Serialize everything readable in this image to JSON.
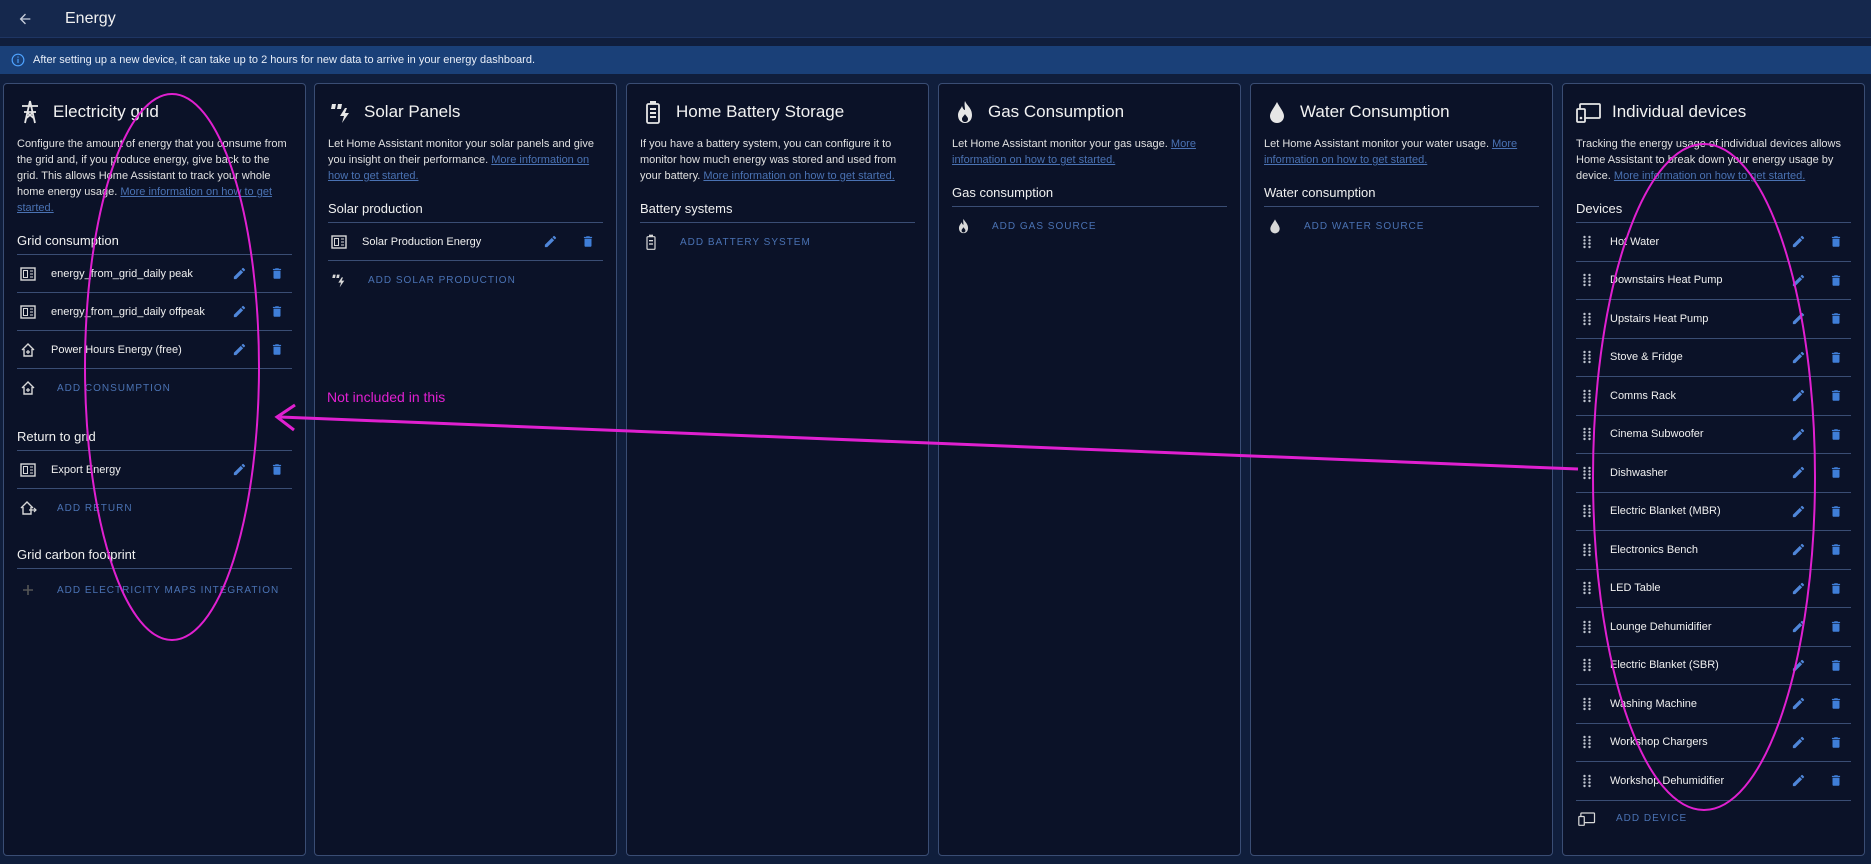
{
  "header": {
    "title": "Energy"
  },
  "banner": {
    "text": "After setting up a new device, it can take up to 2 hours for new data to arrive in your energy dashboard."
  },
  "grid": {
    "title": "Electricity grid",
    "desc": "Configure the amount of energy that you consume from the grid and, if you produce energy, give back to the grid. This allows Home Assistant to track your whole home energy usage.",
    "link": "More information on how to get started.",
    "consumption_heading": "Grid consumption",
    "consumption": [
      {
        "label": "energy_from_grid_daily peak",
        "icon": "meter-icon"
      },
      {
        "label": "energy_from_grid_daily offpeak",
        "icon": "meter-icon"
      },
      {
        "label": "Power Hours Energy (free)",
        "icon": "home-import-icon"
      }
    ],
    "add_consumption": "ADD CONSUMPTION",
    "return_heading": "Return to grid",
    "returns": [
      {
        "label": "Export Energy",
        "icon": "meter-icon"
      }
    ],
    "add_return": "ADD RETURN",
    "carbon_heading": "Grid carbon footprint",
    "add_carbon": "ADD ELECTRICITY MAPS INTEGRATION"
  },
  "solar": {
    "title": "Solar Panels",
    "desc": "Let Home Assistant monitor your solar panels and give you insight on their performance.",
    "link": "More information on how to get started.",
    "section": "Solar production",
    "items": [
      {
        "label": "Solar Production Energy"
      }
    ],
    "add": "ADD SOLAR PRODUCTION"
  },
  "battery": {
    "title": "Home Battery Storage",
    "desc": "If you have a battery system, you can configure it to monitor how much energy was stored and used from your battery.",
    "link": "More information on how to get started.",
    "section": "Battery systems",
    "add": "ADD BATTERY SYSTEM"
  },
  "gas": {
    "title": "Gas Consumption",
    "desc": "Let Home Assistant monitor your gas usage.",
    "link": "More information on how to get started.",
    "section": "Gas consumption",
    "add": "ADD GAS SOURCE"
  },
  "water": {
    "title": "Water Consumption",
    "desc": "Let Home Assistant monitor your water usage.",
    "link": "More information on how to get started.",
    "section": "Water consumption",
    "add": "ADD WATER SOURCE"
  },
  "devices": {
    "title": "Individual devices",
    "desc": "Tracking the energy usage of individual devices allows Home Assistant to break down your energy usage by device.",
    "link": "More information on how to get started.",
    "section": "Devices",
    "items": [
      "Hot Water",
      "Downstairs Heat Pump",
      "Upstairs Heat Pump",
      "Stove & Fridge",
      "Comms Rack",
      "Cinema Subwoofer",
      "Dishwasher",
      "Electric Blanket (MBR)",
      "Electronics Bench",
      "LED Table",
      "Lounge Dehumidifier",
      "Electric Blanket (SBR)",
      "Washing Machine",
      "Workshop Chargers",
      "Workshop Dehumidifier"
    ],
    "add": "ADD DEVICE"
  },
  "annotation": {
    "text": "Not included in this",
    "color": "#e020d0"
  },
  "colors": {
    "accent": "#4a72b3",
    "edit": "#4f86d9",
    "delete": "#3f7ed8"
  }
}
